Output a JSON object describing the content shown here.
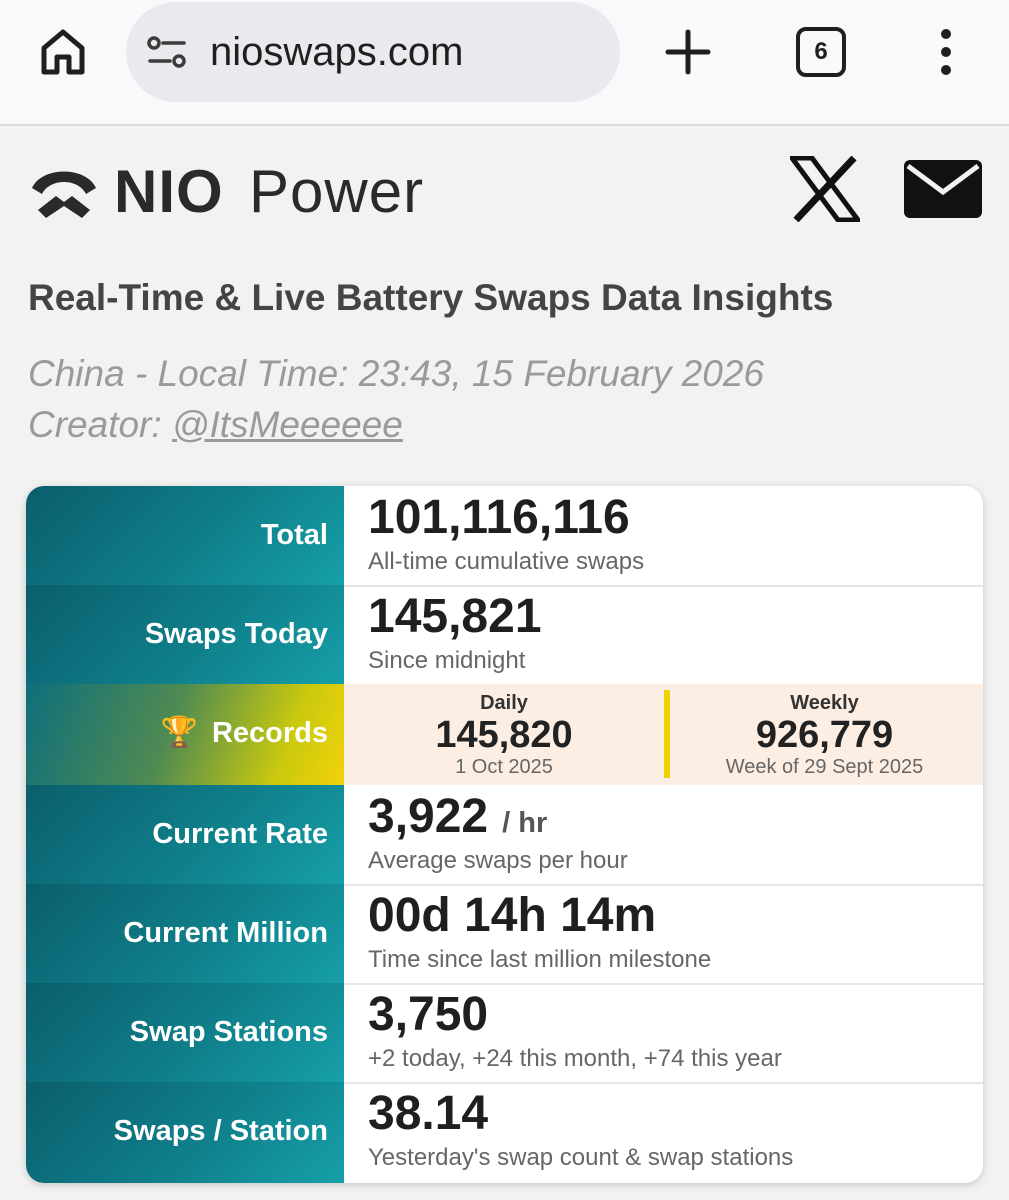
{
  "browser": {
    "url": "nioswaps.com",
    "tab_count": "6",
    "icons": [
      "home-icon",
      "site-settings-icon",
      "plus-icon",
      "tab-switcher-icon",
      "more-vert-icon"
    ]
  },
  "header": {
    "logo_nio": "NIO",
    "logo_power": "Power",
    "icons": [
      "x-logo-icon",
      "mail-icon"
    ]
  },
  "page": {
    "title": "Real-Time & Live Battery Swaps Data Insights",
    "local_time": "China - Local Time: 23:43, 15 February 2026",
    "creator_prefix": "Creator: ",
    "creator_handle": "@ItsMeeeeee"
  },
  "stats": {
    "total": {
      "label": "Total",
      "value": "101,116,116",
      "desc": "All-time cumulative swaps"
    },
    "today": {
      "label": "Swaps Today",
      "value": "145,821",
      "desc": "Since midnight"
    },
    "records": {
      "label": "Records",
      "trophy": "🏆",
      "daily": {
        "head": "Daily",
        "value": "145,820",
        "sub": "1 Oct 2025"
      },
      "weekly": {
        "head": "Weekly",
        "value": "926,779",
        "sub": "Week of 29 Sept 2025"
      }
    },
    "rate": {
      "label": "Current Rate",
      "value": "3,922",
      "unit": "/ hr",
      "desc": "Average swaps per hour"
    },
    "million": {
      "label": "Current Million",
      "value": "00d 14h 14m",
      "desc": "Time since last million milestone"
    },
    "stations": {
      "label": "Swap Stations",
      "value": "3,750",
      "desc": "+2 today, +24 this month, +74 this year"
    },
    "per_station": {
      "label": "Swaps / Station",
      "value": "38.14",
      "desc": "Yesterday's swap count & swap stations"
    }
  },
  "colors": {
    "teal": "#0f7f8a",
    "yellow": "#f2d000",
    "records_bg": "#fdeee3"
  }
}
